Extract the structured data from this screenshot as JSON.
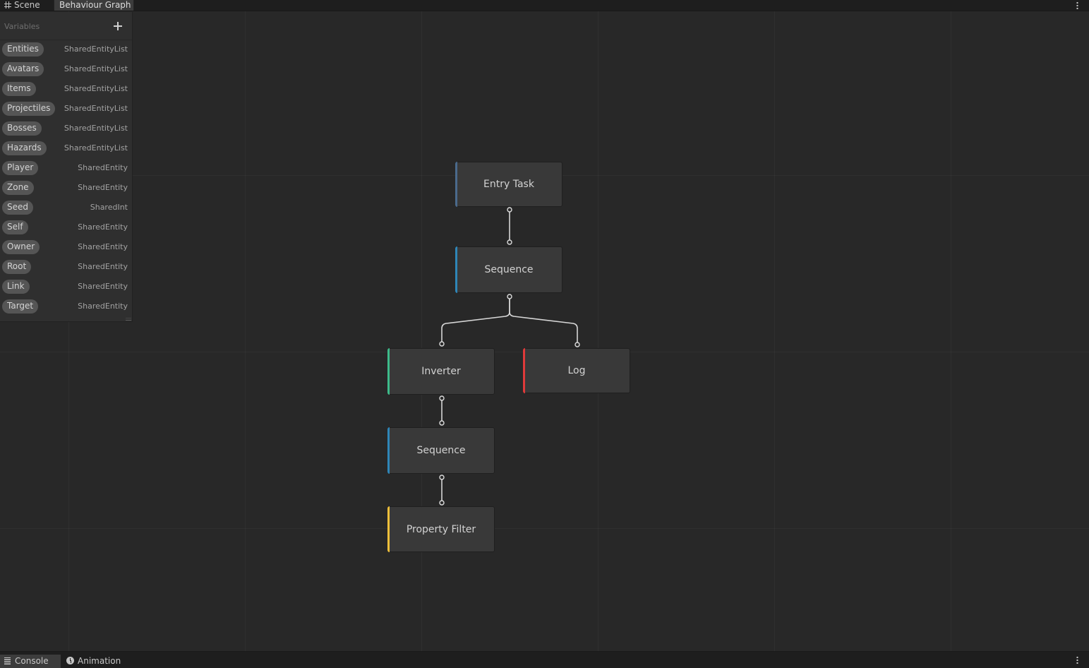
{
  "top_tabs": {
    "scene": "Scene",
    "behaviour_graph": "Behaviour Graph"
  },
  "variables": {
    "title": "Variables",
    "items": [
      {
        "name": "Entities",
        "type": "SharedEntityList"
      },
      {
        "name": "Avatars",
        "type": "SharedEntityList"
      },
      {
        "name": "Items",
        "type": "SharedEntityList"
      },
      {
        "name": "Projectiles",
        "type": "SharedEntityList"
      },
      {
        "name": "Bosses",
        "type": "SharedEntityList"
      },
      {
        "name": "Hazards",
        "type": "SharedEntityList"
      },
      {
        "name": "Player",
        "type": "SharedEntity"
      },
      {
        "name": "Zone",
        "type": "SharedEntity"
      },
      {
        "name": "Seed",
        "type": "SharedInt"
      },
      {
        "name": "Self",
        "type": "SharedEntity"
      },
      {
        "name": "Owner",
        "type": "SharedEntity"
      },
      {
        "name": "Root",
        "type": "SharedEntity"
      },
      {
        "name": "Link",
        "type": "SharedEntity"
      },
      {
        "name": "Target",
        "type": "SharedEntity"
      }
    ]
  },
  "nodes": {
    "entry_task": {
      "label": "Entry Task",
      "accent": "#4a6a8c"
    },
    "sequence_1": {
      "label": "Sequence",
      "accent": "#2e86b8"
    },
    "inverter": {
      "label": "Inverter",
      "accent": "#3dbb8a"
    },
    "log": {
      "label": "Log",
      "accent": "#e03a3a"
    },
    "sequence_2": {
      "label": "Sequence",
      "accent": "#2e86b8"
    },
    "property_filter": {
      "label": "Property Filter",
      "accent": "#f0c03a"
    }
  },
  "bottom_tabs": {
    "console": "Console",
    "animation": "Animation"
  },
  "icons": [
    "grid-icon",
    "plus-icon",
    "more-options-icon",
    "console-icon",
    "clock-icon"
  ]
}
